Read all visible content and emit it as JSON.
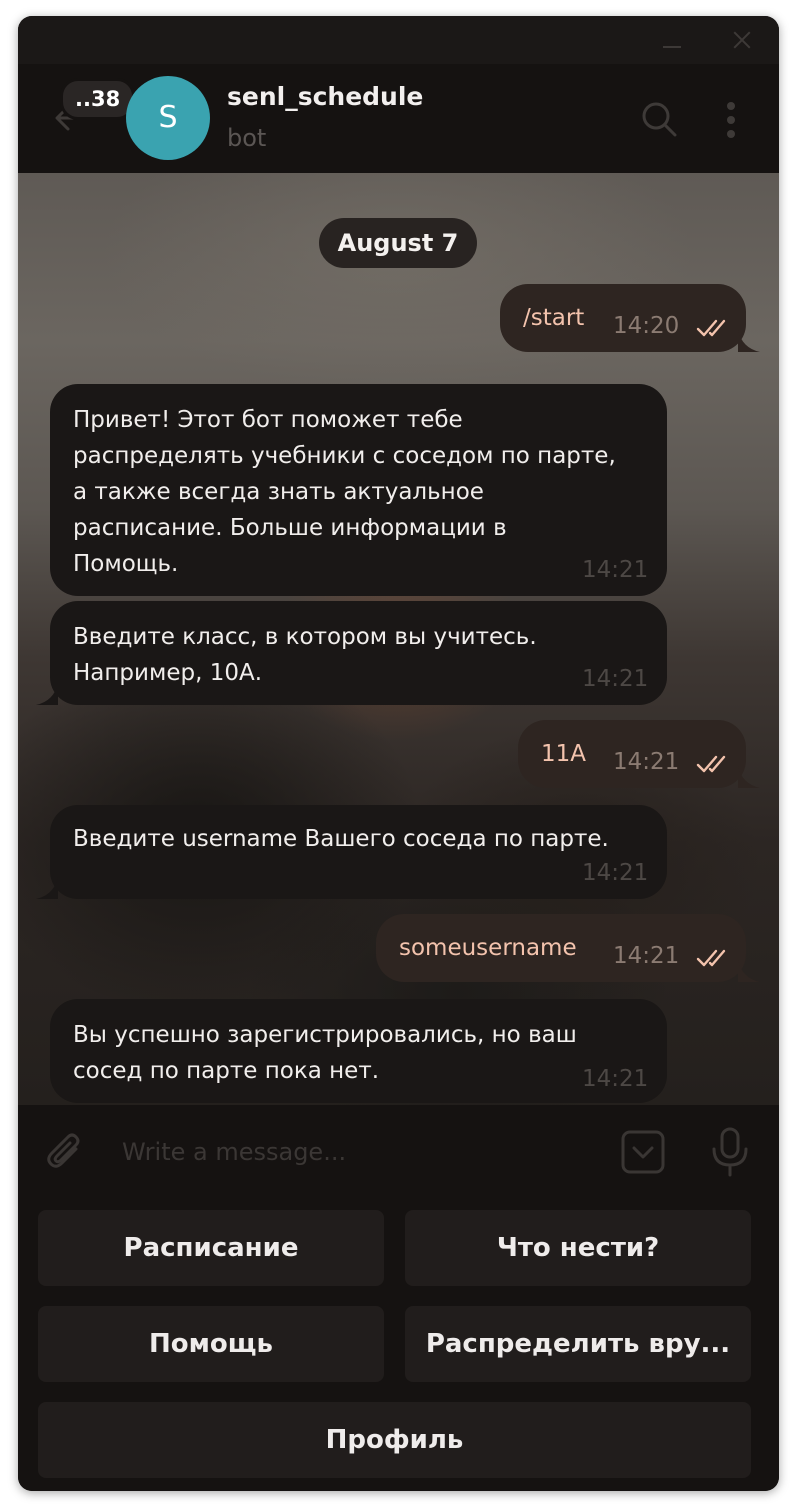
{
  "header": {
    "unread_count": "..38",
    "avatar_letter": "S",
    "title": "senl_schedule",
    "subtitle": "bot",
    "avatar_color": "#3aa3b0"
  },
  "chat": {
    "date_label": "August 7",
    "messages": [
      {
        "direction": "out",
        "text": "/start",
        "time": "14:20",
        "read": true
      },
      {
        "direction": "in",
        "text": "Привет! Этот бот поможет тебе\nраспределять учебники с соседом по парте,\nа также всегда знать актуальное\nрасписание. Больше информации в\nПомощь.",
        "time": "14:21"
      },
      {
        "direction": "in",
        "text": "Введите класс, в котором вы учитесь.\nНапример, 10А.",
        "time": "14:21"
      },
      {
        "direction": "out",
        "text": "11А",
        "time": "14:21",
        "read": true
      },
      {
        "direction": "in",
        "text": "Введите username Вашего соседа по парте.",
        "time": "14:21"
      },
      {
        "direction": "out",
        "text": "someusername",
        "time": "14:21",
        "read": true
      },
      {
        "direction": "in",
        "text": "Вы успешно зарегистрировались, но ваш\nсосед по парте пока нет.",
        "time": "14:21"
      }
    ]
  },
  "composer": {
    "placeholder": "Write a message...",
    "value": ""
  },
  "bot_keyboard": {
    "buttons": [
      "Расписание",
      "Что нести?",
      "Помощь",
      "Распределить вру...",
      "Профиль"
    ]
  },
  "icons": {
    "back": "arrow-left-icon",
    "search": "search-icon",
    "more": "more-vertical-icon",
    "attach": "paperclip-icon",
    "keyboard": "bot-keyboard-icon",
    "mic": "microphone-icon",
    "read": "double-check-icon"
  },
  "colors": {
    "outgoing_text": "#f3c3ad",
    "incoming_bubble": "#1a1716",
    "outgoing_bubble": "#2e2521"
  }
}
